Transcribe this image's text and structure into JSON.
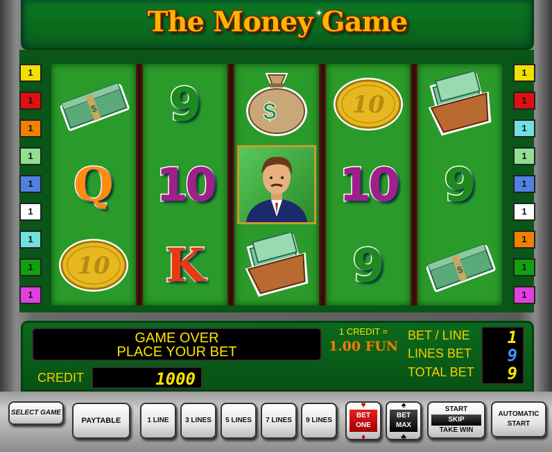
{
  "title": "The Money Game",
  "line_badges_left": [
    {
      "n": "1",
      "color": "#f0e000"
    },
    {
      "n": "1",
      "color": "#e01010"
    },
    {
      "n": "1",
      "color": "#f08000"
    },
    {
      "n": "1",
      "color": "#90e090"
    },
    {
      "n": "1",
      "color": "#5080e0"
    },
    {
      "n": "1",
      "color": "#ffffff"
    },
    {
      "n": "1",
      "color": "#70e0e0"
    },
    {
      "n": "1",
      "color": "#10a010"
    },
    {
      "n": "1",
      "color": "#e040e0"
    }
  ],
  "line_badges_right": [
    {
      "n": "1",
      "color": "#f0e000"
    },
    {
      "n": "1",
      "color": "#e01010"
    },
    {
      "n": "1",
      "color": "#70e0e0"
    },
    {
      "n": "1",
      "color": "#90e090"
    },
    {
      "n": "1",
      "color": "#5080e0"
    },
    {
      "n": "1",
      "color": "#ffffff"
    },
    {
      "n": "1",
      "color": "#f08000"
    },
    {
      "n": "1",
      "color": "#10a010"
    },
    {
      "n": "1",
      "color": "#e040e0"
    }
  ],
  "reels": [
    [
      "cash-stack",
      "Q",
      "gold-coin-10"
    ],
    [
      "9",
      "10",
      "K"
    ],
    [
      "money-bag",
      "businessman",
      "wallet"
    ],
    [
      "gold-coin-10",
      "10",
      "9"
    ],
    [
      "wallet",
      "9",
      "cash-stack"
    ]
  ],
  "symbol_text": {
    "q": "Q",
    "k": "K",
    "nine": "9",
    "ten": "10",
    "coin": "10",
    "bag": "$"
  },
  "message": {
    "line1": "GAME OVER",
    "line2": "PLACE YOUR BET"
  },
  "credit_label": "CREDIT",
  "credit_value": "1000",
  "denomination": {
    "line1": "1 CREDIT =",
    "line2": "1.00 FUN"
  },
  "bet_labels": {
    "bet_line": "BET / LINE",
    "lines_bet": "LINES BET",
    "total_bet": "TOTAL BET"
  },
  "bet_values": {
    "bet_line": "1",
    "lines_bet": "9",
    "total_bet": "9"
  },
  "buttons": {
    "select_game": "SELECT GAME",
    "paytable": "PAYTABLE",
    "line1": "1 LINE",
    "line3": "3 LINES",
    "line5": "5 LINES",
    "line7": "7 LINES",
    "line9": "9 LINES",
    "bet_one_a": "BET",
    "bet_one_b": "ONE",
    "bet_max_a": "BET",
    "bet_max_b": "MAX",
    "start": "START",
    "skip": "SKIP",
    "take_win": "TAKE WIN",
    "auto_a": "AUTOMATIC",
    "auto_b": "START"
  },
  "colors": {
    "table_green": "#2a9a2a",
    "digit_yellow": "#ffe600",
    "digit_blue": "#4a90ff"
  }
}
